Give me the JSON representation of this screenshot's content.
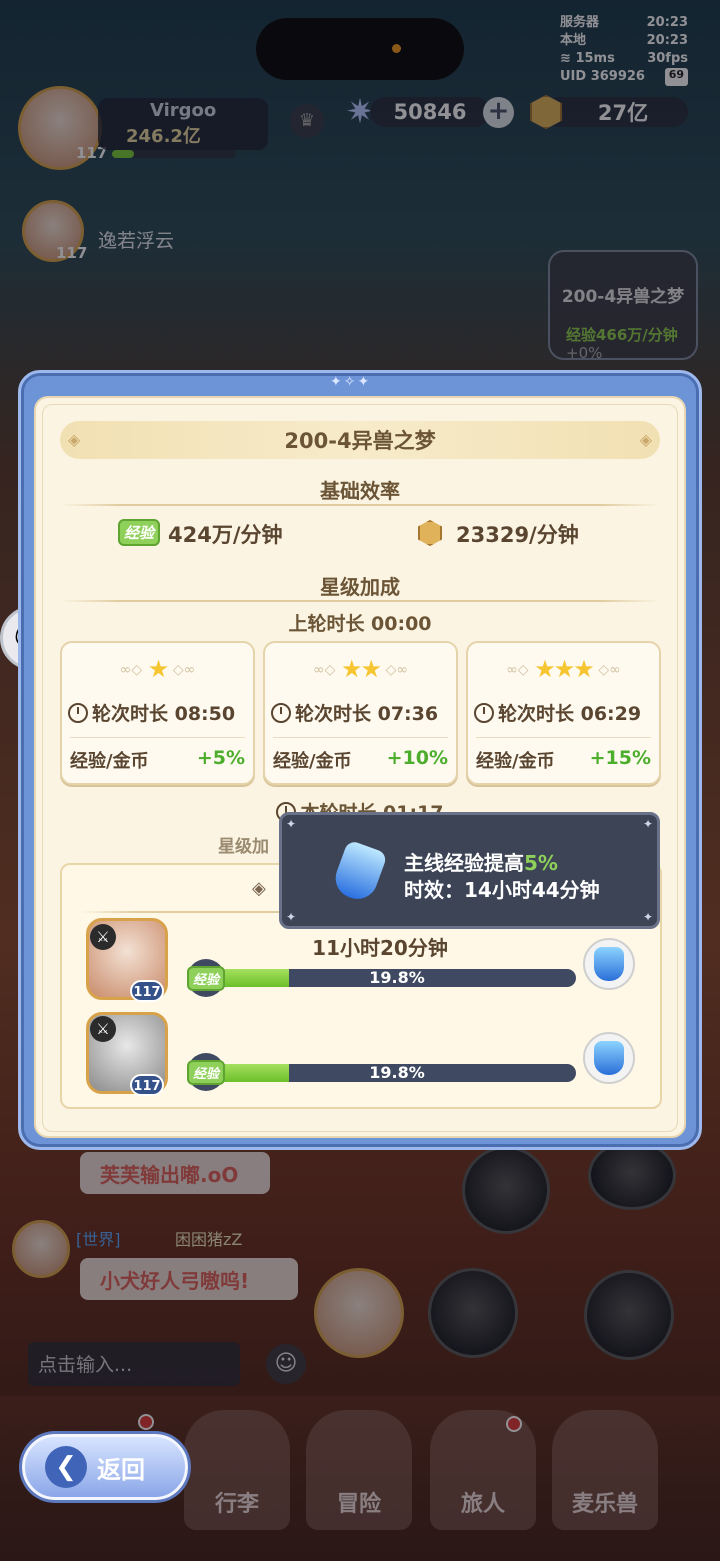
{
  "status": {
    "server_label": "服务器",
    "server_time": "20:23",
    "local_label": "本地",
    "local_time": "20:23",
    "ping": "15ms",
    "fps": "30fps",
    "uid": "UID 369926",
    "battery": "69"
  },
  "resources": {
    "stars": "50846",
    "gold": "27亿"
  },
  "player": {
    "name": "Virgoo",
    "power": "246.2亿",
    "level": "117"
  },
  "member2": {
    "name": "逸若浮云",
    "level": "117"
  },
  "stage_card": {
    "title": "200-4异兽之梦",
    "exp": "经验466万/分钟",
    "bonus": "+0%"
  },
  "dialog": {
    "title": "200-4异兽之梦",
    "base_section": "基础效率",
    "exp_badge": "经验",
    "exp_rate": "424万/分钟",
    "gold_rate": "23329/分钟",
    "star_section": "星级加成",
    "last_round": "上轮时长 00:00",
    "star_cards": [
      {
        "stars": "★",
        "duration": "轮次时长 08:50",
        "label": "经验/金币",
        "bonus": "+5%"
      },
      {
        "stars": "★★",
        "duration": "轮次时长 07:36",
        "label": "经验/金币",
        "bonus": "+10%"
      },
      {
        "stars": "★★★",
        "duration": "轮次时长 06:29",
        "label": "经验/金币",
        "bonus": "+15%"
      }
    ],
    "current_round": "本轮时长 01:17",
    "bonus_note": "星级加",
    "panel_time": "11小时20分钟",
    "members": [
      {
        "level": "117",
        "exp_badge": "经验",
        "percent": "19.8%",
        "progress": 0.198,
        "potion_label": "经验"
      },
      {
        "level": "117",
        "exp_badge": "经验",
        "percent": "19.8%",
        "progress": 0.198,
        "potion_label": "经验"
      }
    ]
  },
  "tooltip": {
    "line1_prefix": "主线经验提高",
    "line1_value": "5%",
    "line2": "时效：14小时44分钟"
  },
  "chat": {
    "msg1": "芙芙输出嘟.oO",
    "world_tag": "[世界]",
    "world_user": "困困猪zZ",
    "msg2": "小犬好人弓嗷呜!",
    "input_placeholder": "点击输入..."
  },
  "nav": {
    "back": "返回",
    "items": [
      "行李",
      "冒险",
      "旅人",
      "麦乐兽"
    ]
  }
}
